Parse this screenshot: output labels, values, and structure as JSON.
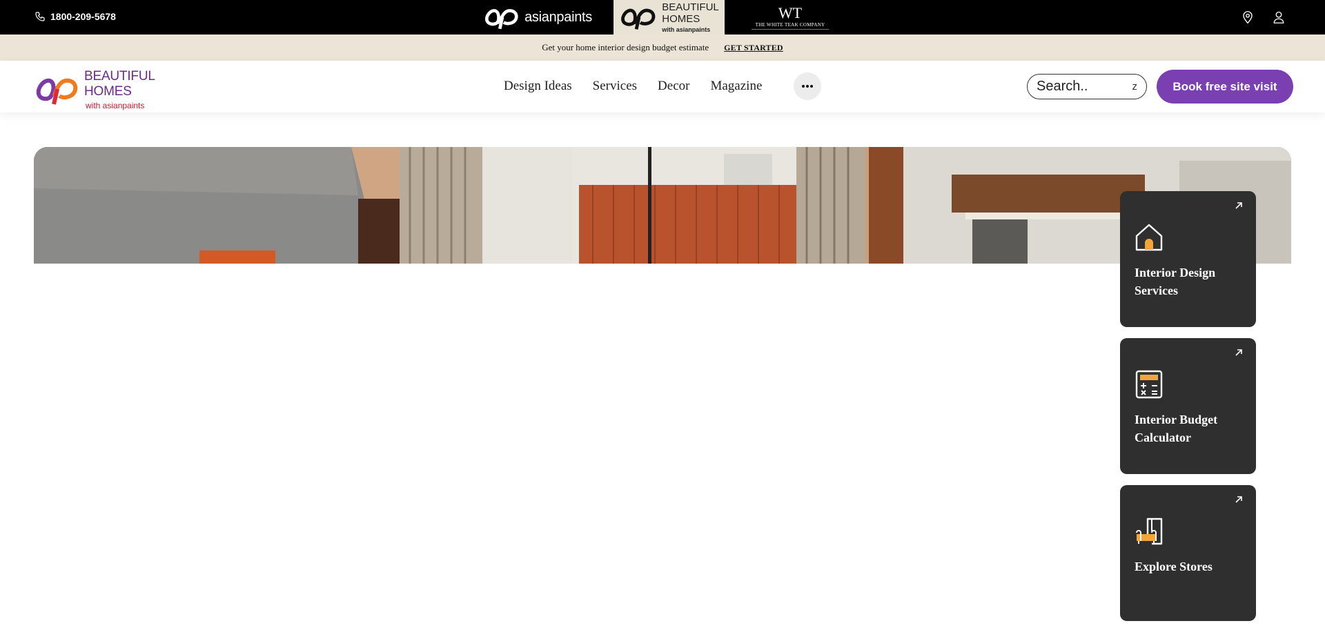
{
  "topbar": {
    "phone": "1800-209-5678",
    "brands": [
      {
        "name": "asianpaints"
      },
      {
        "line1": "BEAUTIFUL",
        "line2": "HOMES",
        "line3": "with asianpaints"
      },
      {
        "monogram": "WT",
        "name": "THE WHITE TEAK COMPANY"
      }
    ]
  },
  "promo": {
    "text": "Get your home interior design budget estimate",
    "link": "GET STARTED"
  },
  "nav": {
    "logo": {
      "line1": "BEAUTIFUL",
      "line2": "HOMES",
      "line3": "with asianpaints"
    },
    "items": [
      "Design Ideas",
      "Services",
      "Decor",
      "Magazine"
    ],
    "search": {
      "placeholder": "Search..",
      "shortcut": "z"
    },
    "cta": "Book free site visit"
  },
  "cards": [
    {
      "title": "Interior Design Services",
      "icon": "house-icon"
    },
    {
      "title": "Interior Budget Calculator",
      "icon": "calculator-icon"
    },
    {
      "title": "Explore Stores",
      "icon": "store-sofa-icon"
    }
  ],
  "colors": {
    "topbar_bg": "#000000",
    "promo_bg": "#ece4d6",
    "cta_bg": "#7a3fb0",
    "card_bg": "#2f2f2f",
    "icon_accent": "#f2a63a"
  }
}
